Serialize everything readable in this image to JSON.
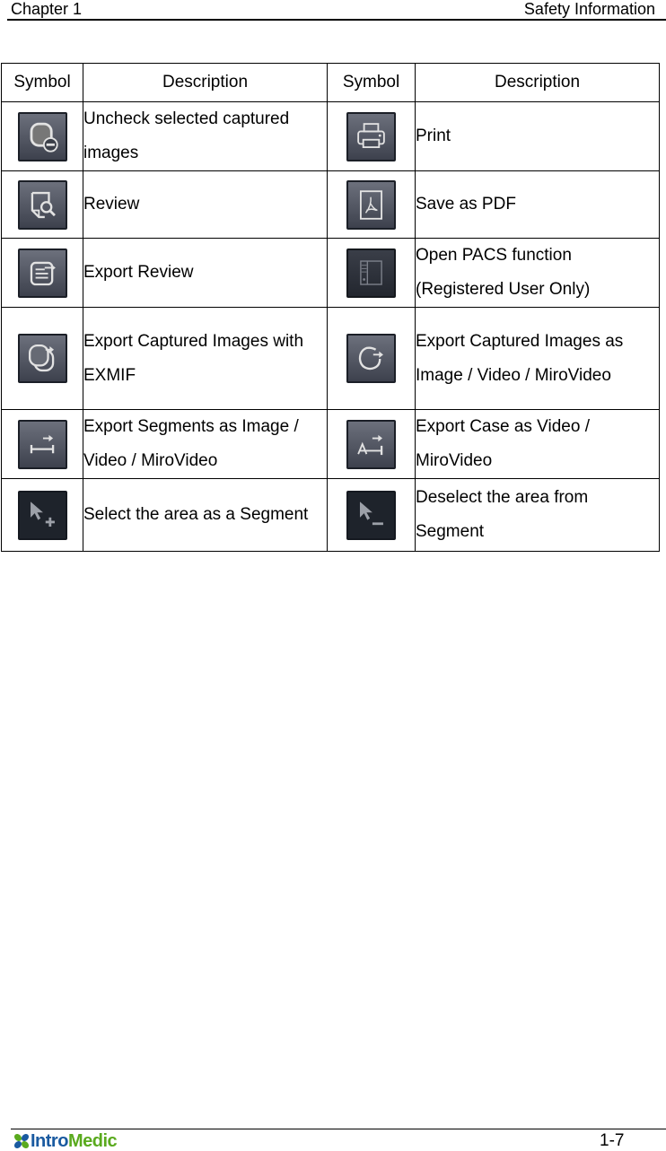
{
  "header": {
    "chapter": "Chapter 1",
    "section": "Safety Information"
  },
  "table": {
    "columns": [
      "Symbol",
      "Description",
      "Symbol",
      "Description"
    ],
    "rows": [
      {
        "left": {
          "icon": "uncheck-captured-images-icon",
          "description": "Uncheck selected captured images"
        },
        "right": {
          "icon": "print-icon",
          "description": "Print"
        }
      },
      {
        "left": {
          "icon": "review-icon",
          "description": "Review"
        },
        "right": {
          "icon": "save-pdf-icon",
          "description": "Save as PDF"
        }
      },
      {
        "left": {
          "icon": "export-review-icon",
          "description": "Export Review"
        },
        "right": {
          "icon": "pacs-icon",
          "description": "Open PACS function (Registered User Only)"
        }
      },
      {
        "left": {
          "icon": "export-captured-exmif-icon",
          "description": "Export Captured Images with EXMIF"
        },
        "right": {
          "icon": "export-captured-images-icon",
          "description": "Export Captured Images as Image / Video / MiroVideo"
        }
      },
      {
        "left": {
          "icon": "export-segments-icon",
          "description": "Export Segments as Image / Video / MiroVideo"
        },
        "right": {
          "icon": "export-case-icon",
          "description": "Export Case as Video / MiroVideo"
        }
      },
      {
        "left": {
          "icon": "select-area-segment-icon",
          "description": "Select the area as a Segment"
        },
        "right": {
          "icon": "deselect-area-segment-icon",
          "description": "Deselect the area from Segment"
        }
      }
    ]
  },
  "footer": {
    "logo_part1": "Intro",
    "logo_part2": "Medic",
    "logo_colors": {
      "green": "#5aaa1e",
      "blue": "#1a5aa0"
    },
    "page_number": "1-7"
  }
}
